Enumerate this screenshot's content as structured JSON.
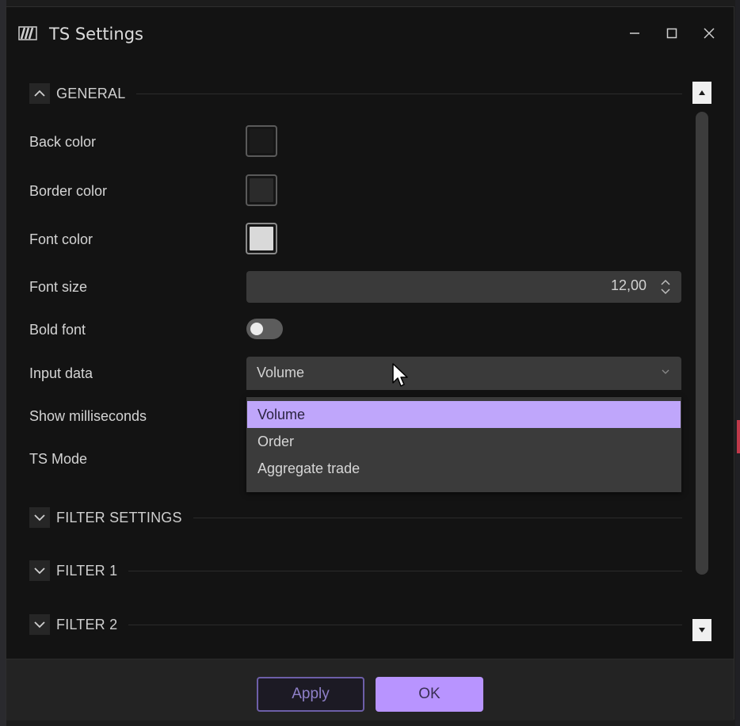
{
  "window": {
    "title": "TS Settings",
    "app_icon": "app-logo-icon",
    "controls": [
      "minimize-icon",
      "maximize-icon",
      "close-icon"
    ]
  },
  "sections": {
    "general": {
      "label": "GENERAL",
      "expanded": true
    },
    "filter_settings": {
      "label": "FILTER SETTINGS",
      "expanded": false
    },
    "filter_1": {
      "label": "FILTER 1",
      "expanded": false
    },
    "filter_2": {
      "label": "FILTER 2",
      "expanded": false
    }
  },
  "settings": {
    "back_color": {
      "label": "Back color",
      "value": "#1b1b1b"
    },
    "border_color": {
      "label": "Border color",
      "value": "#2b2b2b"
    },
    "font_color": {
      "label": "Font color",
      "value": "#d9d9d9"
    },
    "font_size": {
      "label": "Font size",
      "value": "12,00"
    },
    "bold_font": {
      "label": "Bold font",
      "value": false
    },
    "input_data": {
      "label": "Input data",
      "value": "Volume",
      "options": [
        "Volume",
        "Order",
        "Aggregate trade"
      ],
      "selected_index": 0
    },
    "show_milliseconds": {
      "label": "Show milliseconds"
    },
    "ts_mode": {
      "label": "TS Mode"
    }
  },
  "footer": {
    "apply_label": "Apply",
    "ok_label": "OK"
  },
  "colors": {
    "accent": "#b894ff",
    "dropdown_highlight": "#bfa6fb",
    "window_bg": "#131313"
  }
}
